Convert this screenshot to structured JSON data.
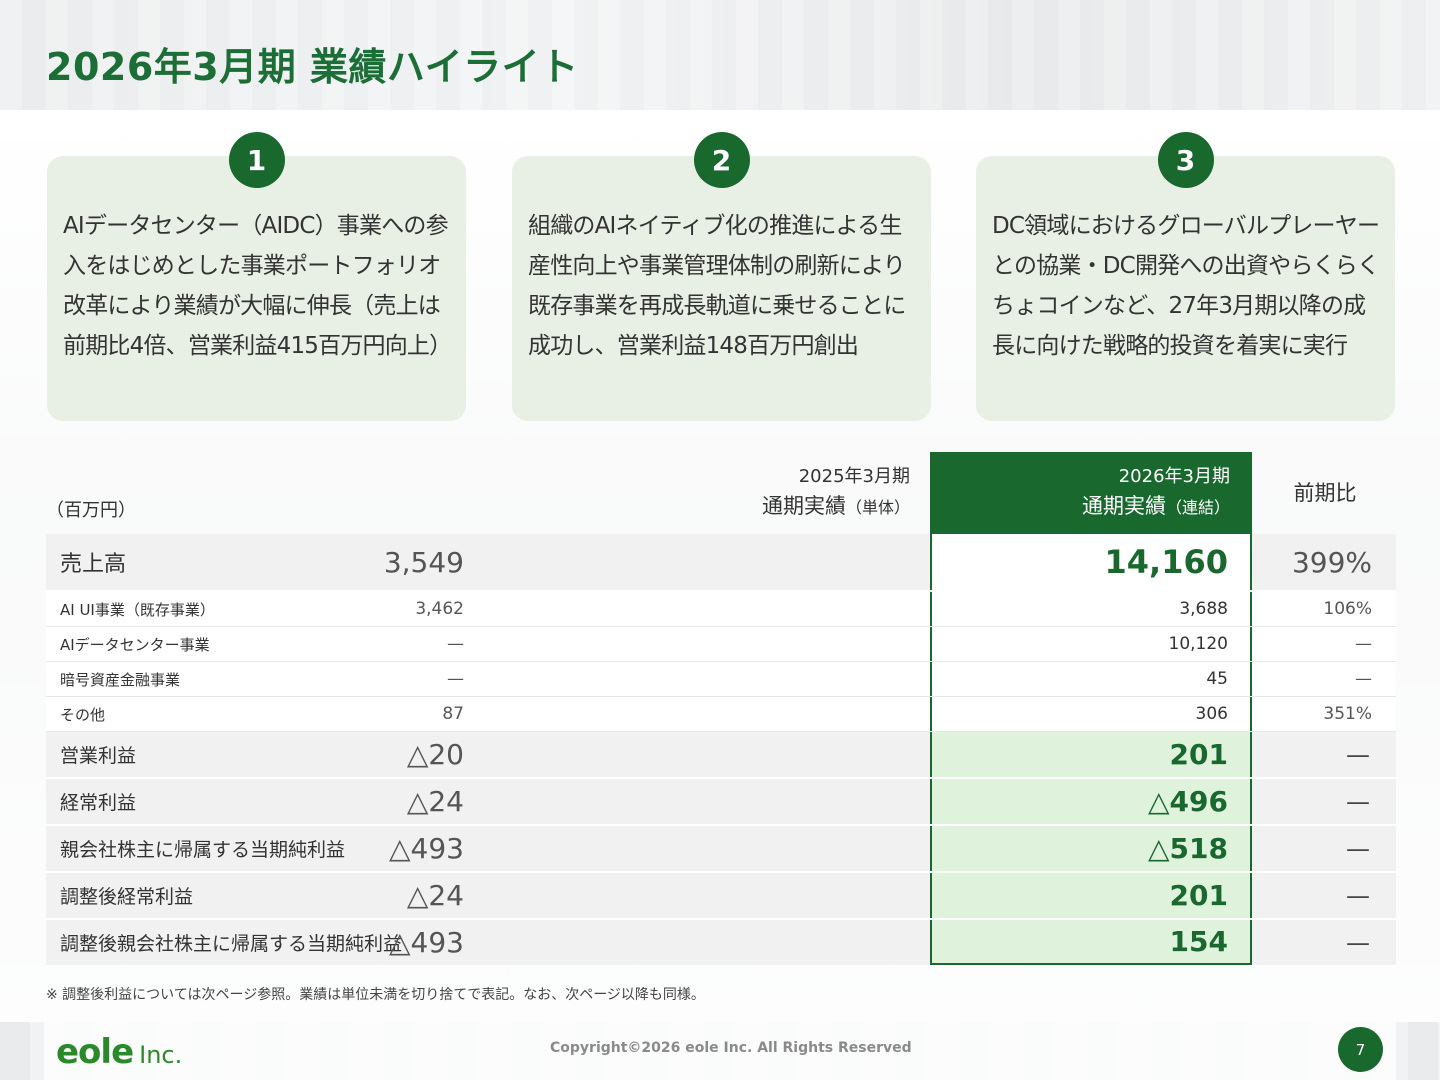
{
  "title": "2026年3月期 業績ハイライト",
  "cards": [
    {
      "num": "1",
      "text": "AIデータセンター（AIDC）事業への参入をはじめとした事業ポートフォリオ改革により業績が大幅に伸長（売上は前期比4倍、営業利益415百万円向上）"
    },
    {
      "num": "2",
      "text": "組織のAIネイティブ化の推進による生産性向上や事業管理体制の刷新により既存事業を再成長軌道に乗せることに成功し、営業利益148百万円創出"
    },
    {
      "num": "3",
      "text": "DC領域におけるグローバルプレーヤーとの協業・DC開発への出資やらくらくちょコインなど、27年3月期以降の成長に向けた戦略的投資を着実に実行"
    }
  ],
  "table": {
    "unit": "（百万円）",
    "head_prev_l1": "2025年3月期",
    "head_prev_l2": "通期実績",
    "head_prev_note": "（単体）",
    "head_cur_l1": "2026年3月期",
    "head_cur_l2": "通期実績",
    "head_cur_note": "（連結）",
    "head_ratio": "前期比",
    "rows": [
      {
        "label": "売上高",
        "prev": "3,549",
        "cur": "14,160",
        "ratio": "399%"
      },
      {
        "label": "AI UI事業（既存事業）",
        "prev": "3,462",
        "cur": "3,688",
        "ratio": "106%"
      },
      {
        "label": "AIデータセンター事業",
        "prev": "—",
        "cur": "10,120",
        "ratio": "—"
      },
      {
        "label": "暗号資産金融事業",
        "prev": "—",
        "cur": "45",
        "ratio": "—"
      },
      {
        "label": "その他",
        "prev": "87",
        "cur": "306",
        "ratio": "351%"
      },
      {
        "label": "営業利益",
        "prev": "△20",
        "cur": "201",
        "ratio": "—"
      },
      {
        "label": "経常利益",
        "prev": "△24",
        "cur": "△496",
        "ratio": "—"
      },
      {
        "label": "親会社株主に帰属する当期純利益",
        "prev": "△493",
        "cur": "△518",
        "ratio": "—"
      },
      {
        "label": "調整後経常利益",
        "prev": "△24",
        "cur": "201",
        "ratio": "—"
      },
      {
        "label": "調整後親会社株主に帰属する当期純利益",
        "prev": "△493",
        "cur": "154",
        "ratio": "—"
      }
    ]
  },
  "note": "※ 調整後利益については次ページ参照。業績は単位未満を切り捨てで表記。なお、次ページ以降も同様。",
  "footer": {
    "logo_main": "eole",
    "logo_sub": "Inc.",
    "copyright": "Copyright©2026 eole Inc. All Rights Reserved",
    "page": "7"
  },
  "colors": {
    "brand_green": "#19692f",
    "card_bg": "#e8f0e6",
    "highlight_bg": "#dff2dc"
  }
}
